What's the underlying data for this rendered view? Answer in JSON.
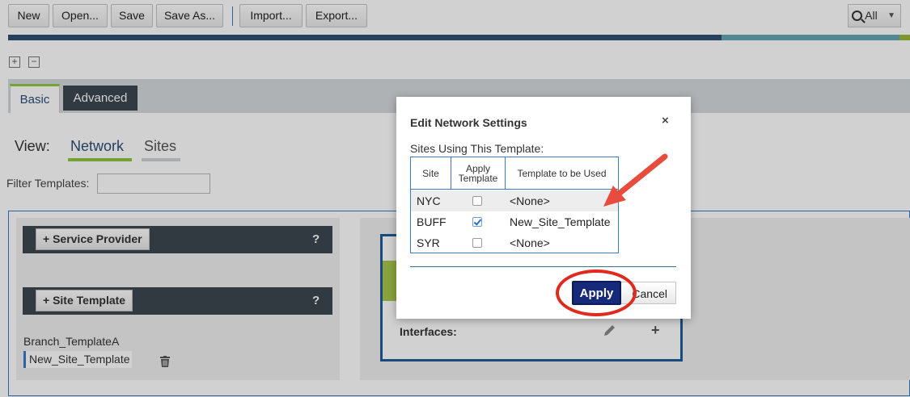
{
  "toolbar": {
    "new": "New",
    "open": "Open...",
    "save": "Save",
    "save_as": "Save As...",
    "import": "Import...",
    "export": "Export...",
    "search_scope": "All"
  },
  "tabs": {
    "basic": "Basic",
    "advanced": "Advanced"
  },
  "view": {
    "label": "View:",
    "network": "Network",
    "sites": "Sites"
  },
  "filter": {
    "label": "Filter Templates:",
    "value": ""
  },
  "left_panel": {
    "service_provider": "Service Provider",
    "site_template": "Site Template",
    "help": "?",
    "templates": [
      "Branch_TemplateA",
      "New_Site_Template"
    ]
  },
  "network_card": {
    "interfaces_label": "Interfaces:"
  },
  "dialog": {
    "title": "Edit Network Settings",
    "close": "×",
    "subtitle": "Sites Using This Template:",
    "headers": {
      "site": "Site",
      "apply": "Apply Template",
      "template": "Template to be Used"
    },
    "rows": [
      {
        "site": "NYC",
        "applied": false,
        "template": "<None>"
      },
      {
        "site": "BUFF",
        "applied": true,
        "template": "New_Site_Template"
      },
      {
        "site": "SYR",
        "applied": false,
        "template": "<None>"
      }
    ],
    "apply_button": "Apply",
    "cancel_button": "Cancel"
  },
  "colors": {
    "accent_blue": "#3a7bc8",
    "green_accent": "#8fc641",
    "dark_header": "#3c4650",
    "apply_navy": "#172a7a",
    "annotation_red": "#e02a1d"
  }
}
